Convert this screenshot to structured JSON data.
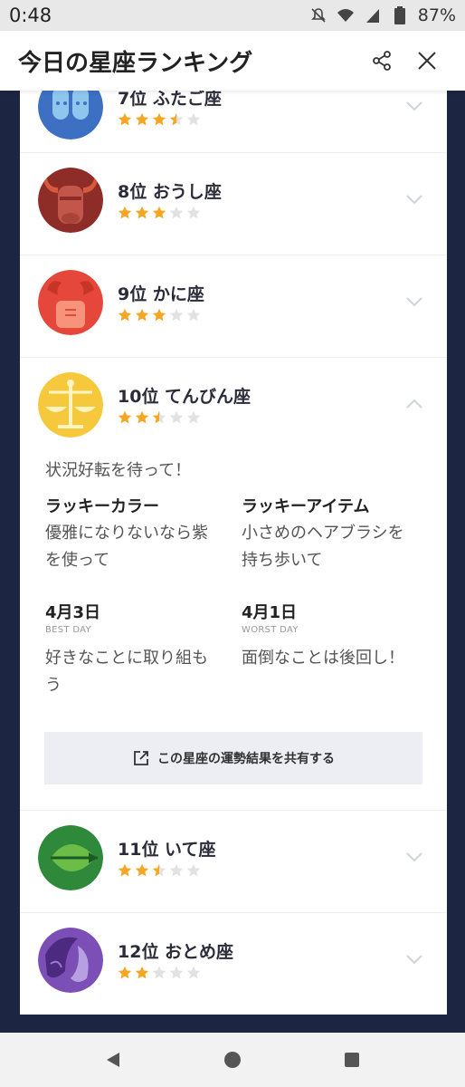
{
  "status": {
    "time": "0:48",
    "battery": "87%"
  },
  "header": {
    "title": "今日の星座ランキング"
  },
  "colors": {
    "star_on": "#f5a623",
    "star_off": "#e2e2e2",
    "navy": "#1c2541"
  },
  "rows": [
    {
      "rank_title": "7位 ふたご座",
      "rating": 3.5
    },
    {
      "rank_title": "8位 おうし座",
      "rating": 3
    },
    {
      "rank_title": "9位 かに座",
      "rating": 3
    },
    {
      "rank_title": "10位 てんびん座",
      "rating": 2.5
    },
    {
      "rank_title": "11位 いて座",
      "rating": 2.5
    },
    {
      "rank_title": "12位 おとめ座",
      "rating": 2
    }
  ],
  "detail": {
    "message": "状況好転を待って！",
    "lucky_color_label": "ラッキーカラー",
    "lucky_color_value": "優雅になりないなら紫を使って",
    "lucky_item_label": "ラッキーアイテム",
    "lucky_item_value": "小さめのヘアブラシを持ち歩いて",
    "best_day_date": "4月3日",
    "best_day_label": "BEST DAY",
    "best_day_value": "好きなことに取り組もう",
    "worst_day_date": "4月1日",
    "worst_day_label": "WORST DAY",
    "worst_day_value": "面倒なことは後回し！",
    "share_label": "この星座の運勢結果を共有する"
  }
}
